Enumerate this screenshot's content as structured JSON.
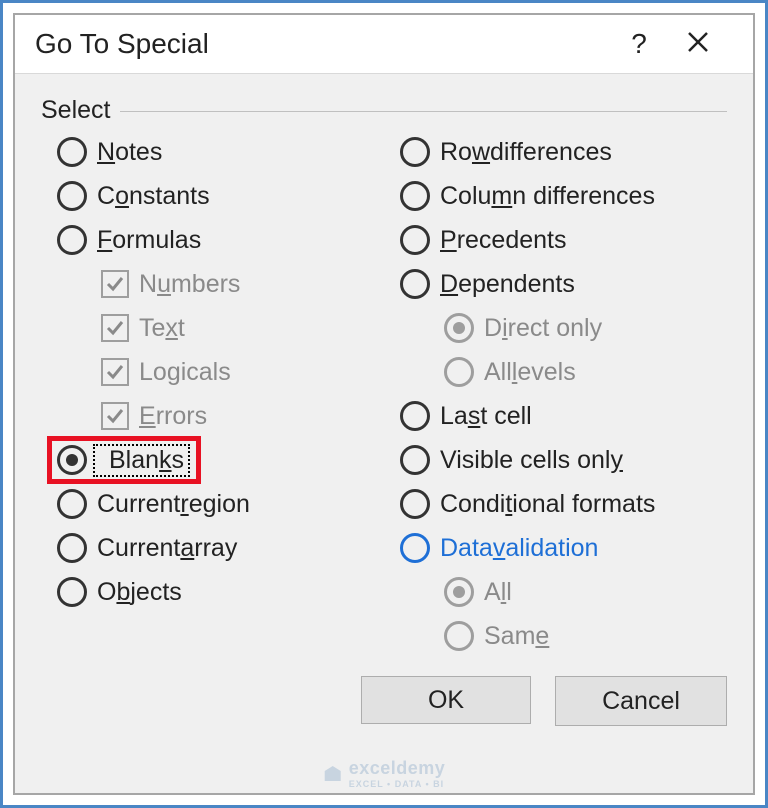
{
  "dialog": {
    "title": "Go To Special",
    "help_label": "?",
    "group_label": "Select"
  },
  "left": [
    {
      "id": "notes",
      "kind": "radio",
      "pre": "",
      "u": "N",
      "post": "otes",
      "selected": false
    },
    {
      "id": "constants",
      "kind": "radio",
      "pre": "C",
      "u": "o",
      "post": "nstants",
      "selected": false
    },
    {
      "id": "formulas",
      "kind": "radio",
      "pre": "",
      "u": "F",
      "post": "ormulas",
      "selected": false
    },
    {
      "id": "numbers",
      "kind": "check",
      "pre": "N",
      "u": "u",
      "post": "mbers",
      "checked": true,
      "disabled": true,
      "sub": true
    },
    {
      "id": "text",
      "kind": "check",
      "pre": "Te",
      "u": "x",
      "post": "t",
      "checked": true,
      "disabled": true,
      "sub": true
    },
    {
      "id": "logicals",
      "kind": "check",
      "pre": "Lo",
      "u": "g",
      "post": "icals",
      "checked": true,
      "disabled": true,
      "sub": true
    },
    {
      "id": "errors",
      "kind": "check",
      "pre": "",
      "u": "E",
      "post": "rrors",
      "checked": true,
      "disabled": true,
      "sub": true
    },
    {
      "id": "blanks",
      "kind": "radio",
      "pre": "Blan",
      "u": "k",
      "post": "s",
      "selected": true,
      "focused": true,
      "highlight": "red"
    },
    {
      "id": "region",
      "kind": "radio",
      "pre": "Current ",
      "u": "r",
      "post": "egion",
      "selected": false
    },
    {
      "id": "array",
      "kind": "radio",
      "pre": "Current ",
      "u": "a",
      "post": "rray",
      "selected": false
    },
    {
      "id": "objects",
      "kind": "radio",
      "pre": "O",
      "u": "b",
      "post": "jects",
      "selected": false
    }
  ],
  "right": [
    {
      "id": "rowdiff",
      "kind": "radio",
      "pre": "Ro",
      "u": "w",
      "post": " differences",
      "selected": false
    },
    {
      "id": "coldiff",
      "kind": "radio",
      "pre": "Colu",
      "u": "m",
      "post": "n differences",
      "selected": false
    },
    {
      "id": "preced",
      "kind": "radio",
      "pre": "",
      "u": "P",
      "post": "recedents",
      "selected": false
    },
    {
      "id": "depend",
      "kind": "radio",
      "pre": "",
      "u": "D",
      "post": "ependents",
      "selected": false
    },
    {
      "id": "direct",
      "kind": "radio",
      "pre": "D",
      "u": "i",
      "post": "rect only",
      "selected": true,
      "disabled": true,
      "sub": true
    },
    {
      "id": "alllev",
      "kind": "radio",
      "pre": "All ",
      "u": "l",
      "post": "evels",
      "selected": false,
      "disabled": true,
      "sub": true
    },
    {
      "id": "lastcell",
      "kind": "radio",
      "pre": "La",
      "u": "s",
      "post": "t cell",
      "selected": false
    },
    {
      "id": "visible",
      "kind": "radio",
      "pre": "Visible cells onl",
      "u": "y",
      "post": "",
      "selected": false
    },
    {
      "id": "condfmt",
      "kind": "radio",
      "pre": "Condi",
      "u": "t",
      "post": "ional formats",
      "selected": false
    },
    {
      "id": "datavald",
      "kind": "radio",
      "pre": "Data ",
      "u": "v",
      "post": "alidation",
      "selected": false,
      "blue": true
    },
    {
      "id": "all",
      "kind": "radio",
      "pre": "A",
      "u": "l",
      "post": "l",
      "selected": true,
      "disabled": true,
      "sub": true
    },
    {
      "id": "same",
      "kind": "radio",
      "pre": "Sam",
      "u": "e",
      "post": "",
      "selected": false,
      "disabled": true,
      "sub": true
    }
  ],
  "buttons": {
    "ok": "OK",
    "cancel": "Cancel"
  },
  "watermark": {
    "brand": "exceldemy",
    "tag": "EXCEL • DATA • BI"
  }
}
